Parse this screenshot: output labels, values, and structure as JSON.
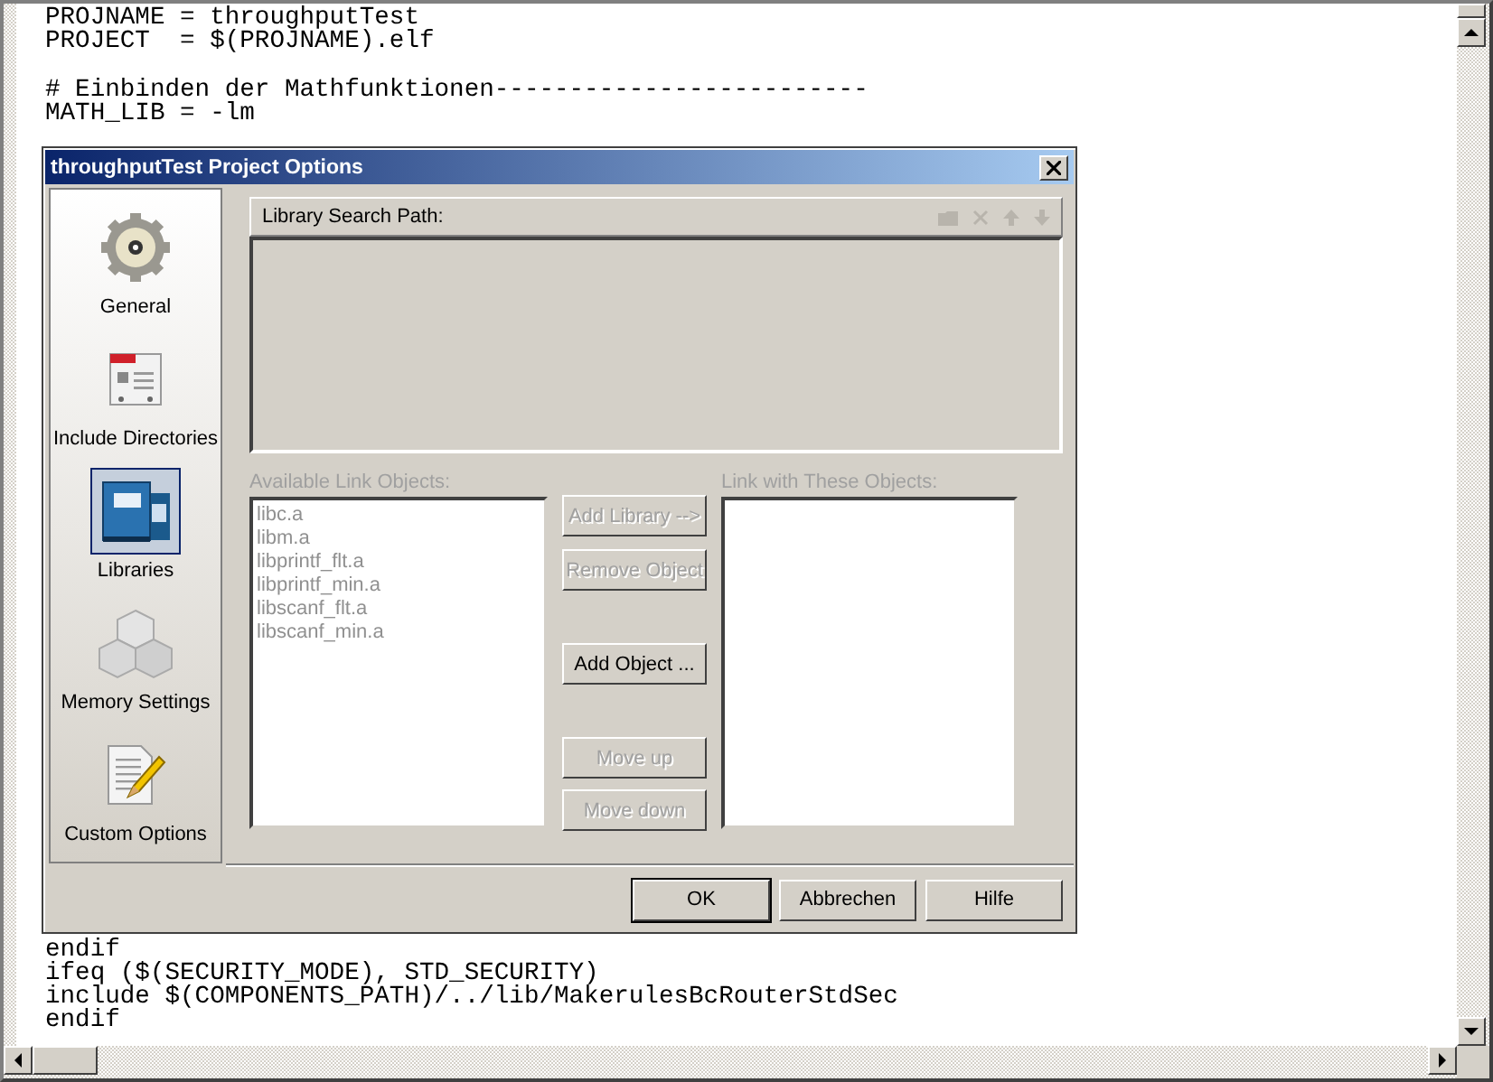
{
  "editor": {
    "lines_top": [
      "PROJNAME = throughputTest",
      "PROJECT  = $(PROJNAME).elf",
      "# Einbinden der Mathfunktionen-------------------------",
      "MATH_LIB = -lm"
    ],
    "lines_bottom": [
      "endif",
      "ifeq ($(SECURITY_MODE), STD_SECURITY)",
      "include $(COMPONENTS_PATH)/../lib/MakerulesBcRouterStdSec",
      "endif"
    ]
  },
  "dialog": {
    "title": "throughputTest Project Options",
    "sidebar": [
      {
        "label": "General",
        "selected": false
      },
      {
        "label": "Include Directories",
        "selected": false
      },
      {
        "label": "Libraries",
        "selected": true
      },
      {
        "label": "Memory Settings",
        "selected": false
      },
      {
        "label": "Custom Options",
        "selected": false
      }
    ],
    "search_path": {
      "label": "Library Search Path:",
      "disabled": true
    },
    "available": {
      "label": "Available Link Objects:",
      "disabled": true,
      "items": [
        "libc.a",
        "libm.a",
        "libprintf_flt.a",
        "libprintf_min.a",
        "libscanf_flt.a",
        "libscanf_min.a"
      ]
    },
    "link_with": {
      "label": "Link with These Objects:",
      "disabled": true
    },
    "buttons": [
      {
        "label": "Add Library -->",
        "disabled": true
      },
      {
        "label": "Remove Object",
        "disabled": true
      },
      {
        "label": "Add Object ...",
        "disabled": false
      },
      {
        "label": "Move up",
        "disabled": true
      },
      {
        "label": "Move down",
        "disabled": true
      }
    ],
    "footer": [
      {
        "label": "OK",
        "default": true
      },
      {
        "label": "Abbrechen",
        "default": false
      },
      {
        "label": "Hilfe",
        "default": false
      }
    ]
  }
}
